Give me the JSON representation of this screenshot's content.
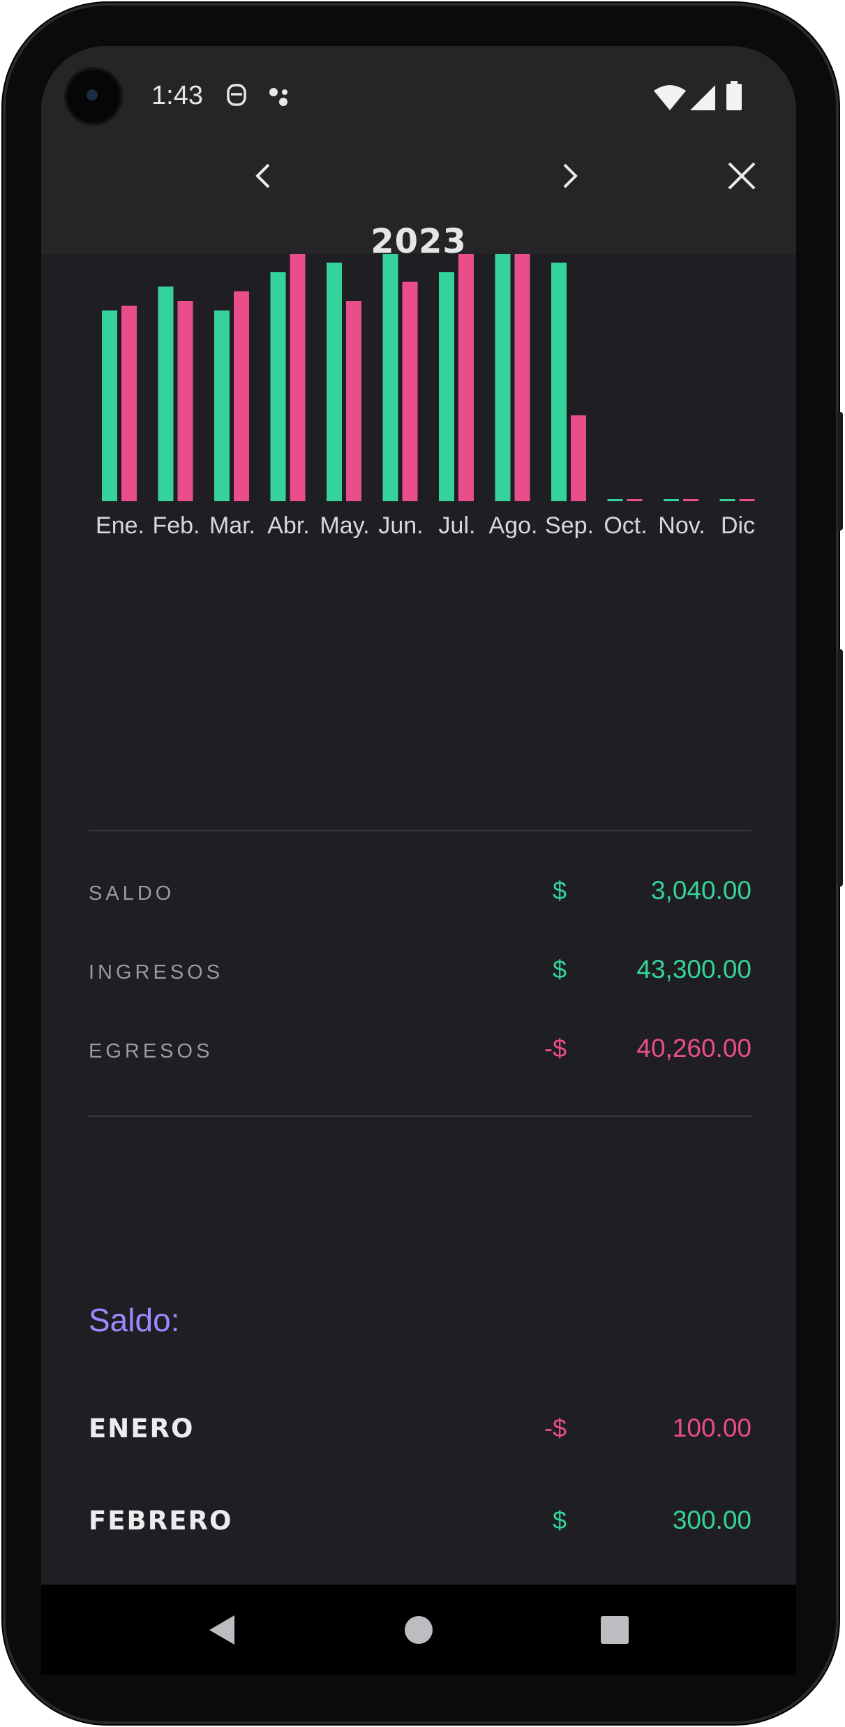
{
  "status_bar": {
    "time": "1:43",
    "icons": [
      "notification-icon",
      "assistant-icon",
      "wifi-icon",
      "signal-icon",
      "battery-icon"
    ]
  },
  "header": {
    "year": "2023",
    "prev_icon": "chevron-left-icon",
    "next_icon": "chevron-right-icon",
    "close_icon": "close-icon"
  },
  "colors": {
    "income": "#35d39b",
    "expense": "#ea4d8c",
    "accent": "#a087ff",
    "background": "#1f1e22"
  },
  "chart_data": {
    "type": "bar",
    "categories": [
      "Ene.",
      "Feb.",
      "Mar.",
      "Abr.",
      "May.",
      "Jun.",
      "Jul.",
      "Ago.",
      "Sep.",
      "Oct.",
      "Nov.",
      "Dic"
    ],
    "series": [
      {
        "values": [
          4000,
          4500,
          4000,
          4800,
          5000,
          5200,
          4800,
          6000,
          5000,
          0,
          0,
          0
        ],
        "color": "#35d39b"
      },
      {
        "values": [
          4100,
          4200,
          4400,
          5200,
          4200,
          4600,
          6000,
          5800,
          1800,
          0,
          0,
          0
        ],
        "color": "#ea4d8c"
      }
    ],
    "ylim": [
      0,
      6000
    ],
    "grid": false,
    "legend": "none"
  },
  "summary": {
    "rows": [
      {
        "label": "SALDO",
        "symbol": "$",
        "value": "3,040.00",
        "tone": "green"
      },
      {
        "label": "INGRESOS",
        "symbol": "$",
        "value": "43,300.00",
        "tone": "green"
      },
      {
        "label": "EGRESOS",
        "symbol": "-$",
        "value": "40,260.00",
        "tone": "pink"
      }
    ]
  },
  "saldo_section": {
    "title": "Saldo:",
    "months": [
      {
        "name": "ENERO",
        "symbol": "-$",
        "value": "100.00",
        "tone": "pink"
      },
      {
        "name": "FEBRERO",
        "symbol": "$",
        "value": "300.00",
        "tone": "green"
      }
    ]
  },
  "nav_bar": {
    "icons": [
      "back-icon",
      "home-icon",
      "recents-icon"
    ]
  }
}
